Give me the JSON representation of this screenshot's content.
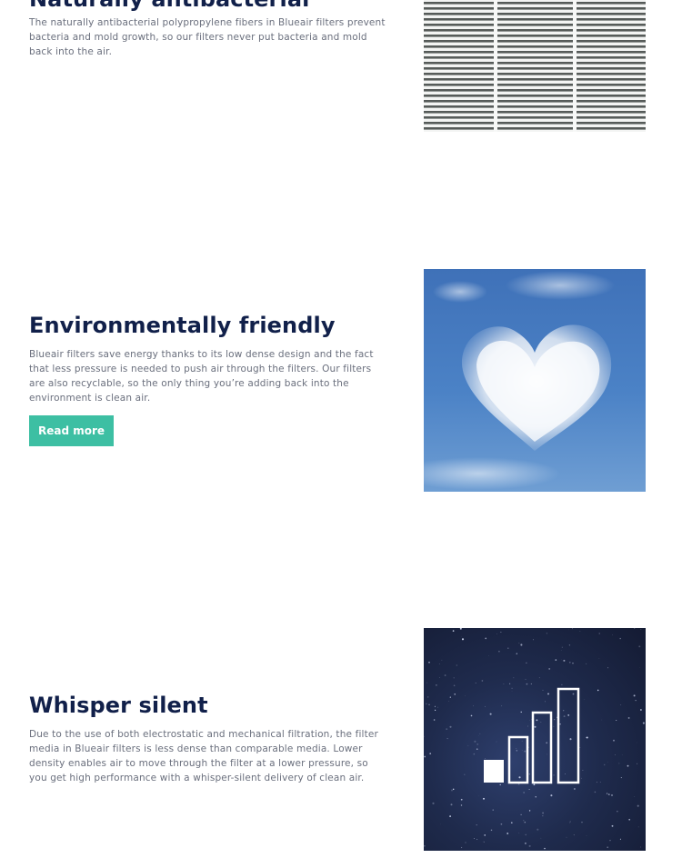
{
  "sections": [
    {
      "title": "Naturally antibacterial",
      "body": "The naturally antibacterial polypropylene fibers in Blueair filters prevent bacteria and mold growth, so our filters never put bacteria and mold back into the air.",
      "image_alt": "filter-pleats"
    },
    {
      "title": "Environmentally friendly",
      "body": "Blueair filters save energy thanks to its low dense design and the fact that less pressure is needed to push air through the filters. Our filters are also recyclable, so the only thing you’re adding back into the environment is clean air.",
      "button_label": "Read more",
      "image_alt": "heart-cloud"
    },
    {
      "title": "Whisper silent",
      "body": "Due to the use of both electrostatic and mechanical filtration, the filter media in Blueair filters is less dense than comparable media. Lower density enables air to move through the filter at a lower pressure, so you get high performance with a whisper-silent delivery of clean air.",
      "image_alt": "signal-bars-night-sky"
    }
  ],
  "colors": {
    "title": "#11204a",
    "body": "#6a6f7d",
    "button": "#3dbfa3",
    "button_text": "#ffffff"
  }
}
